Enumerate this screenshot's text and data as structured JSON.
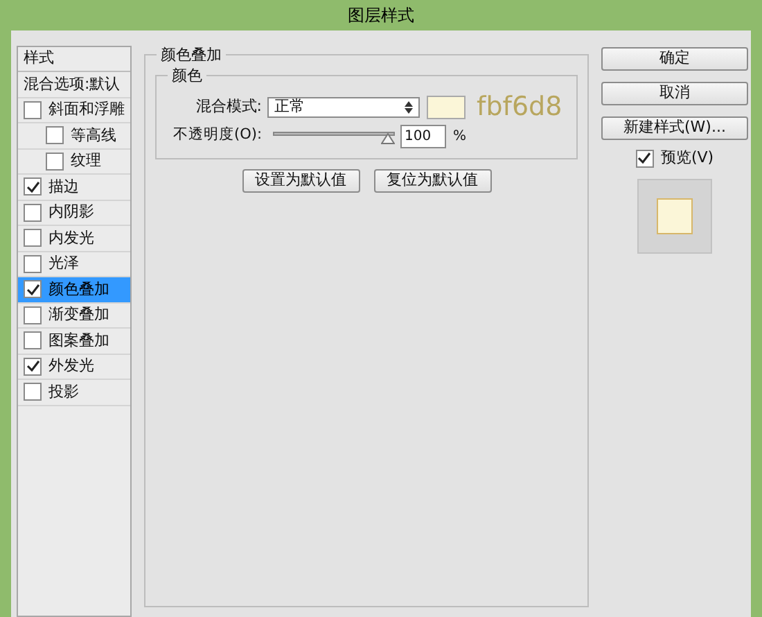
{
  "window": {
    "title": "图层样式"
  },
  "sidebar": {
    "header": "样式",
    "items": [
      {
        "kind": "plain",
        "label": "混合选项:默认",
        "selected": false
      },
      {
        "kind": "check",
        "label": "斜面和浮雕",
        "checked": false,
        "selected": false,
        "children": [
          {
            "kind": "check",
            "label": "等高线",
            "checked": false,
            "selected": false
          },
          {
            "kind": "check",
            "label": "纹理",
            "checked": false,
            "selected": false
          }
        ]
      },
      {
        "kind": "check",
        "label": "描边",
        "checked": true,
        "selected": false
      },
      {
        "kind": "check",
        "label": "内阴影",
        "checked": false,
        "selected": false
      },
      {
        "kind": "check",
        "label": "内发光",
        "checked": false,
        "selected": false
      },
      {
        "kind": "check",
        "label": "光泽",
        "checked": false,
        "selected": false
      },
      {
        "kind": "check",
        "label": "颜色叠加",
        "checked": true,
        "selected": true
      },
      {
        "kind": "check",
        "label": "渐变叠加",
        "checked": false,
        "selected": false
      },
      {
        "kind": "check",
        "label": "图案叠加",
        "checked": false,
        "selected": false
      },
      {
        "kind": "check",
        "label": "外发光",
        "checked": true,
        "selected": false
      },
      {
        "kind": "check",
        "label": "投影",
        "checked": false,
        "selected": false
      }
    ]
  },
  "panel": {
    "title": "颜色叠加",
    "group": "颜色",
    "blend_label": "混合模式:",
    "blend_value": "正常",
    "color": "#fbf6d8",
    "color_note": "fbf6d8",
    "opacity_label": "不透明度(O):",
    "opacity": {
      "level": 1
    },
    "opacity_value": "100",
    "unit": "%",
    "buttons": [
      "设置为默认值",
      "复位为默认值"
    ]
  },
  "actions": {
    "buttons": [
      "确定",
      "取消",
      "新建样式(W)..."
    ],
    "preview": {
      "label": "预览(V)",
      "checked": true
    }
  }
}
